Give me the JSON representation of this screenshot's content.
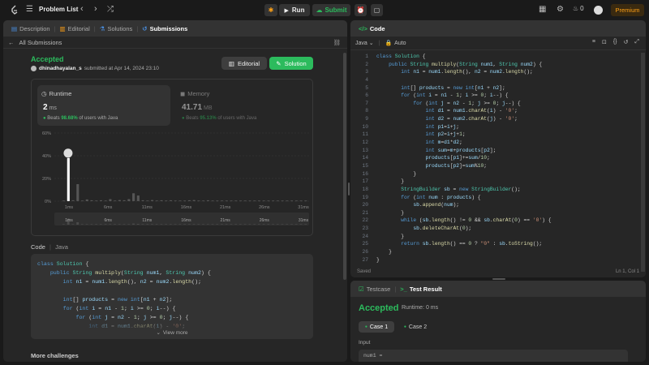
{
  "topbar": {
    "problem_list": "Problem List",
    "run": "Run",
    "submit": "Submit",
    "fire_count": "0",
    "premium": "Premium"
  },
  "left_tabs": [
    {
      "label": "Description"
    },
    {
      "label": "Editorial"
    },
    {
      "label": "Solutions"
    },
    {
      "label": "Submissions"
    }
  ],
  "submission": {
    "back": "All Submissions",
    "status": "Accepted",
    "user": "dhinadhayalan_s",
    "submitted": " submitted at Apr 14, 2024 23:10",
    "editorial_btn": "Editorial",
    "solution_btn": "Solution"
  },
  "runtime": {
    "label": "Runtime",
    "value": "2",
    "unit": "ms",
    "beats_pre": "Beats ",
    "beats_pct": "98.68%",
    "beats_post": " of users with Java"
  },
  "memory": {
    "label": "Memory",
    "value": "41.71",
    "unit": "MB",
    "beats_pre": "Beats ",
    "beats_pct": "95.13%",
    "beats_post": " of users with Java"
  },
  "chart_data": {
    "type": "bar",
    "y_ticks": [
      "60%",
      "40%",
      "20%",
      "0%"
    ],
    "ylim": [
      0,
      60
    ],
    "x_ticks": [
      "1ms",
      "6ms",
      "11ms",
      "16ms",
      "21ms",
      "26ms",
      "31ms"
    ],
    "values": [
      0.5,
      38,
      0.8,
      15,
      0.5,
      1.5,
      0.8,
      0.5,
      0.8,
      0.5,
      1.8,
      0.5,
      1,
      0.8,
      1.8,
      7,
      5,
      0.8,
      0.5,
      1,
      0.5,
      0.8,
      0.5,
      0.8,
      0.5,
      0.5,
      0.5,
      0.8,
      1,
      0.5,
      0.5,
      0.8,
      0.5,
      0.5,
      0.5,
      0.5,
      0.5,
      0.5,
      0.5,
      0.5,
      0.5,
      0.5,
      0.5,
      0.5,
      0.5,
      0.5,
      0.5,
      0.5,
      0.5,
      0.5,
      0.5,
      0.5,
      0.5
    ],
    "highlight_index": 1
  },
  "code_section": {
    "label": "Code",
    "lang": "Java",
    "view_more": "View more"
  },
  "more": "More challenges",
  "code_panel": {
    "title": "Code",
    "lang": "Java",
    "auto": "Auto",
    "saved": "Saved",
    "cursor": "Ln 1, Col 1"
  },
  "code_lines": [
    "class Solution {",
    "    public String multiply(String num1, String num2) {",
    "        int n1 = num1.length(), n2 = num2.length();",
    "",
    "        int[] products = new int[n1 + n2];",
    "        for (int i = n1 - 1; i >= 0; i--) {",
    "            for (int j = n2 - 1; j >= 0; j--) {",
    "                int d1 = num1.charAt(i) - '0';",
    "                int d2 = num2.charAt(j) - '0';",
    "                int p1=i+j;",
    "                int p2=i+j+1;",
    "                int m=d1*d2;",
    "                int sum=m+products[p2];",
    "                products[p1]+=sum/10;",
    "                products[p2]=sum%10;",
    "            }",
    "        }",
    "        StringBuilder sb = new StringBuilder();",
    "        for (int num : products) {",
    "            sb.append(num);",
    "        }",
    "        while (sb.length() != 0 && sb.charAt(0) == '0') {",
    "            sb.deleteCharAt(0);",
    "        }",
    "        return sb.length() == 0 ? \"0\" : sb.toString();",
    "    }",
    "}"
  ],
  "test": {
    "tab1": "Testcase",
    "tab2": "Test Result",
    "status": "Accepted",
    "runtime": "Runtime: 0 ms",
    "case1": "Case 1",
    "case2": "Case 2",
    "input_label": "Input",
    "input_value": "num1 ="
  }
}
